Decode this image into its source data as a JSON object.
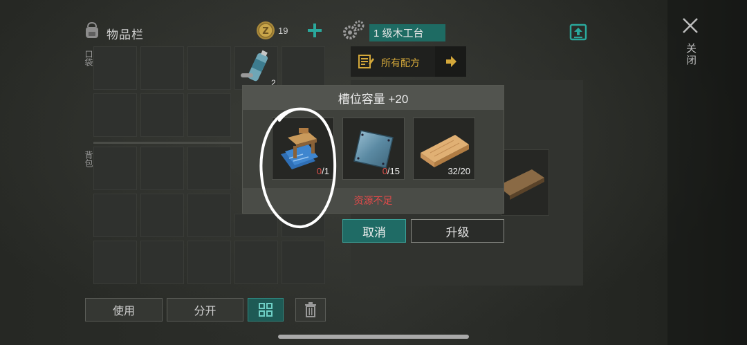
{
  "inventory": {
    "title": "物品栏",
    "coins": "19",
    "pocket_label": "口袋",
    "backpack_label": "背包",
    "item_count": "2",
    "use_label": "使用",
    "split_label": "分开"
  },
  "crafting": {
    "bench_label": "1 级木工台",
    "all_recipes_label": "所有配方"
  },
  "upgrade_modal": {
    "title": "槽位容量 +20",
    "requirements": [
      {
        "name": "blueprint-icon",
        "have": "0",
        "need": "/1"
      },
      {
        "name": "metal-sheet-icon",
        "have": "0",
        "need": "/15"
      },
      {
        "name": "wooden-plank-icon",
        "have": "32",
        "need": "/20"
      }
    ],
    "status": "资源不足",
    "cancel_label": "取消",
    "upgrade_label": "升级"
  },
  "close_label": "关闭",
  "colors": {
    "accent": "#1f6b65",
    "warning": "#e24a4a",
    "background": "#2b2d2a"
  }
}
